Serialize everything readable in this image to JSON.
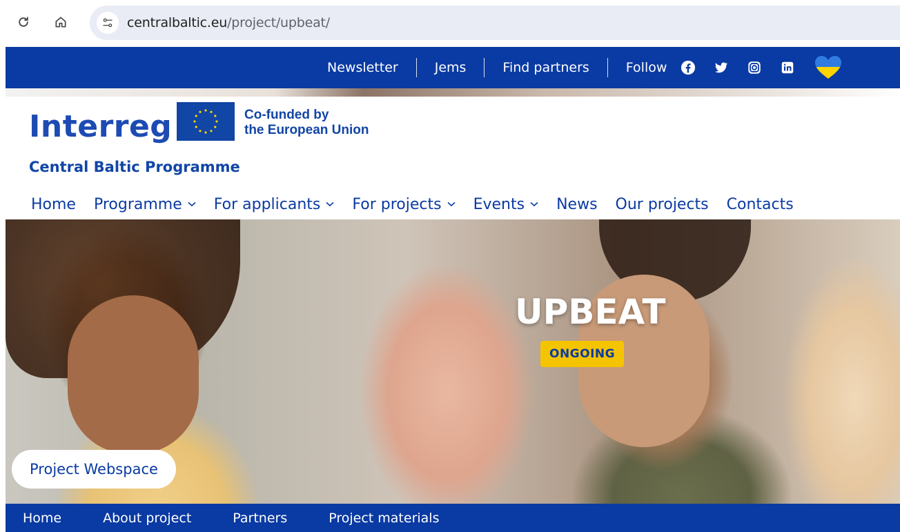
{
  "browser": {
    "url_host": "centralbaltic.eu",
    "url_path": "/project/upbeat/"
  },
  "utility_bar": {
    "links": [
      "Newsletter",
      "Jems",
      "Find partners"
    ],
    "follow_label": "Follow",
    "social_icons": [
      "facebook-icon",
      "twitter-icon",
      "instagram-icon",
      "linkedin-icon"
    ]
  },
  "header": {
    "logo_text": "Interreg",
    "cofunded_line1": "Co-funded by",
    "cofunded_line2": "the European Union",
    "programme_name": "Central Baltic Programme"
  },
  "main_nav": {
    "items": [
      {
        "label": "Home",
        "dropdown": false
      },
      {
        "label": "Programme",
        "dropdown": true
      },
      {
        "label": "For applicants",
        "dropdown": true
      },
      {
        "label": "For projects",
        "dropdown": true
      },
      {
        "label": "Events",
        "dropdown": true
      },
      {
        "label": "News",
        "dropdown": false
      },
      {
        "label": "Our projects",
        "dropdown": false
      },
      {
        "label": "Contacts",
        "dropdown": false
      }
    ],
    "chevron": "⌄"
  },
  "hero": {
    "title": "UPBEAT",
    "status": "ONGOING",
    "webspace_button": "Project Webspace"
  },
  "project_nav": {
    "items": [
      "Home",
      "About project",
      "Partners",
      "Project materials"
    ]
  },
  "colors": {
    "brand_blue": "#0a3aa3",
    "badge_yellow": "#f5c400"
  }
}
